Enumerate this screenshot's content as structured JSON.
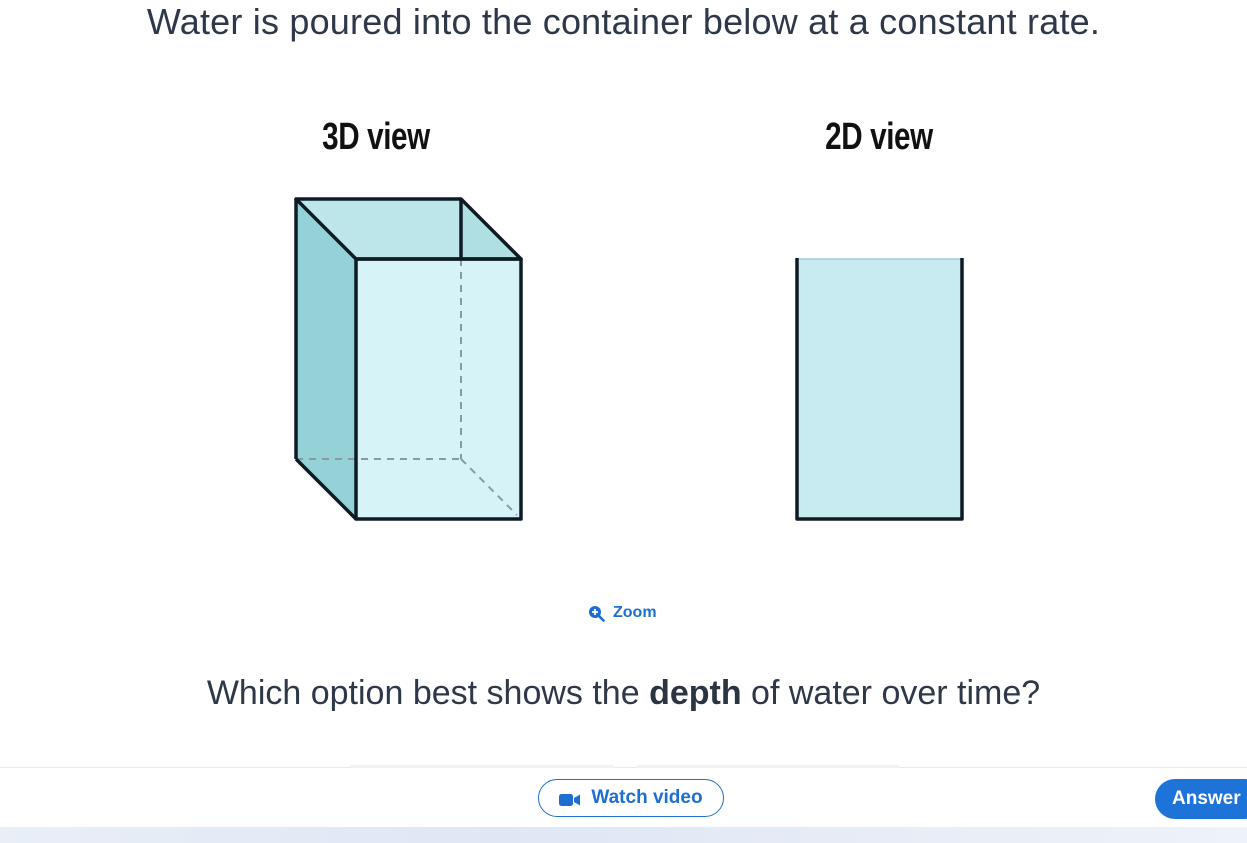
{
  "question": {
    "intro": "Water is poured into the container below at a constant rate.",
    "prompt_before": "Which option best shows the ",
    "prompt_bold": "depth",
    "prompt_after": " of water over time?"
  },
  "figure": {
    "label_3d": "3D view",
    "label_2d": "2D view",
    "colors": {
      "front_face": "#d6f4f7",
      "side_face": "#94d2d8",
      "top_face": "#bde6ea",
      "back_right": "#b0dfe3",
      "outline": "#0f1b24",
      "hidden_edge": "#8a9aa3",
      "fill_2d": "#c7ebf1"
    }
  },
  "zoom": {
    "label": "Zoom",
    "icon": "zoom-in-icon"
  },
  "footer": {
    "watch_video_label": "Watch video",
    "watch_video_icon": "video-camera-icon",
    "answer_label": "Answer"
  },
  "colors": {
    "accent": "#1d6fd1",
    "text": "#2e3848"
  }
}
